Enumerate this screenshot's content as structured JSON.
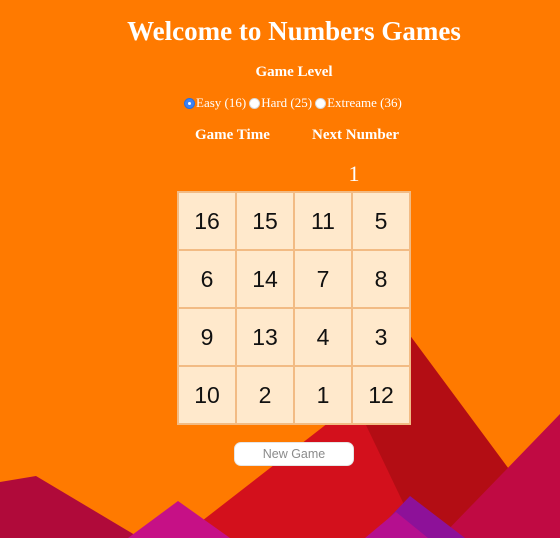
{
  "header": {
    "title": "Welcome to Numbers Games",
    "game_level_label": "Game Level"
  },
  "levels": [
    {
      "label": "Easy (16)",
      "selected": true
    },
    {
      "label": "Hard (25)",
      "selected": false
    },
    {
      "label": "Extreame (36)",
      "selected": false
    }
  ],
  "stats": {
    "game_time_label": "Game Time",
    "game_time_value": "",
    "next_number_label": "Next Number",
    "next_number_value": "1"
  },
  "board": {
    "rows": [
      [
        "16",
        "15",
        "11",
        "5"
      ],
      [
        "6",
        "14",
        "7",
        "8"
      ],
      [
        "9",
        "13",
        "4",
        "3"
      ],
      [
        "10",
        "2",
        "1",
        "12"
      ]
    ]
  },
  "controls": {
    "new_game_label": "New Game"
  },
  "colors": {
    "background": "#ff7a00",
    "tile": "#ffe9cc",
    "tile_border": "#f2bb84",
    "mountain_dark_red": "#b30d14",
    "mountain_red": "#d3101c",
    "mountain_crimson": "#c00a43",
    "mountain_magenta": "#c61086",
    "mountain_purple": "#8d1199"
  }
}
